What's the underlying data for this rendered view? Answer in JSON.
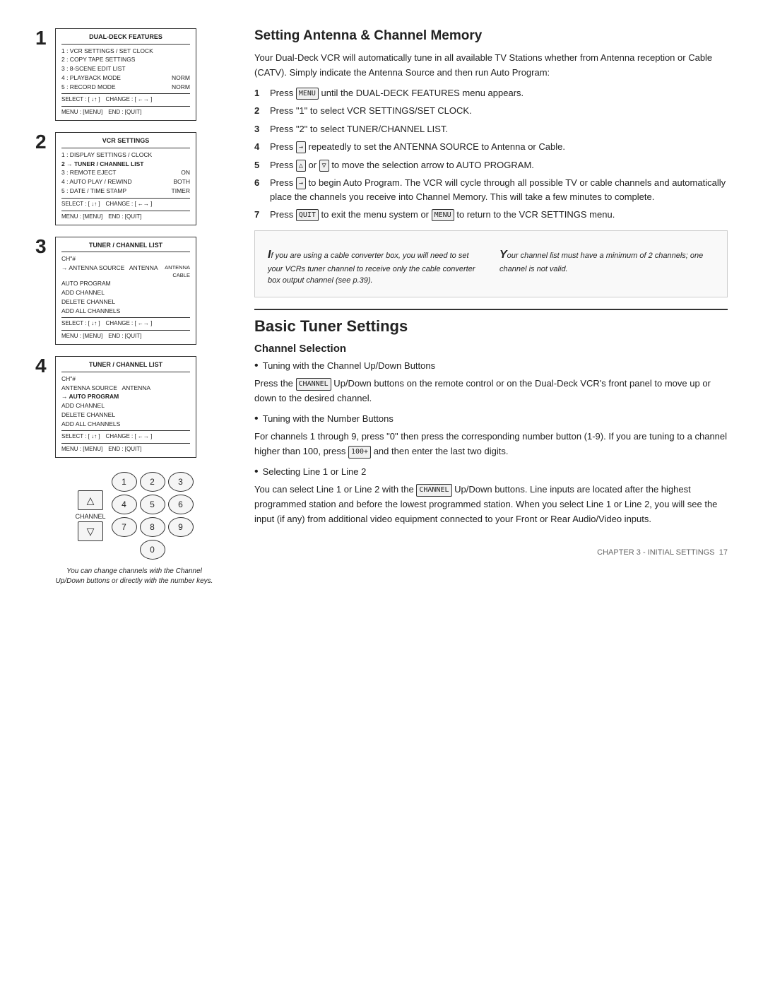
{
  "page": {
    "chapter_footer": "CHAPTER 3 - INITIAL SETTINGS",
    "page_number": "17"
  },
  "left_col": {
    "steps": [
      {
        "number": "1",
        "menu": {
          "title": "DUAL-DECK FEATURES",
          "rows": [
            {
              "num": "1 :",
              "label": "VCR SETTINGS / SET CLOCK"
            },
            {
              "num": "2 :",
              "label": "COPY TAPE SETTINGS"
            },
            {
              "num": "3 :",
              "label": "8-SCENE EDIT LIST"
            },
            {
              "num": "4 :",
              "label": "PLAYBACK MODE",
              "value": "NORM"
            },
            {
              "num": "5 :",
              "label": "RECORD MODE",
              "value": "NORM"
            }
          ],
          "footer": "SELECT : [ ↓↑ ]   CHANGE : [ ←→ ]\nMENU : [MENU]          END : [QUIT]"
        }
      },
      {
        "number": "2",
        "menu": {
          "title": "VCR SETTINGS",
          "rows": [
            {
              "num": "1 :",
              "label": "DISPLAY SETTINGS / CLOCK"
            },
            {
              "num": "2 →",
              "label": "TUNER / CHANNEL LIST"
            },
            {
              "num": "3 :",
              "label": "REMOTE EJECT",
              "value": "ON"
            },
            {
              "num": "4 :",
              "label": "AUTO PLAY / REWIND",
              "value": "BOTH"
            },
            {
              "num": "5 :",
              "label": "DATE / TIME STAMP",
              "value": "TIMER"
            }
          ],
          "footer": "SELECT : [ ↓↑ ]   CHANGE : [ ←→ ]\nMENU : [MENU]          END : [QUIT]"
        }
      },
      {
        "number": "3",
        "menu": {
          "title": "TUNER / CHANNEL LIST",
          "rows_special": [
            {
              "label": "CH\"#"
            },
            {
              "label": "→ ANTENNA SOURCE   ANTENNA",
              "sub": "ANTENNA\nCABLE"
            },
            {
              "label": "AUTO PROGRAM"
            },
            {
              "label": "ADD CHANNEL"
            },
            {
              "label": "DELETE CHANNEL"
            },
            {
              "label": "ADD ALL CHANNELS"
            }
          ],
          "footer": "SELECT : [ ↓↑ ]   CHANGE : [ ←→ ]\nMENU : [MENU]          END : [QUIT]"
        }
      },
      {
        "number": "4",
        "menu": {
          "title": "TUNER / CHANNEL LIST",
          "rows_special": [
            {
              "label": "CH\"#"
            },
            {
              "label": "ANTENNA SOURCE   ANTENNA"
            },
            {
              "label": "→ AUTO PROGRAM",
              "bold": true
            },
            {
              "label": "ADD CHANNEL"
            },
            {
              "label": "DELETE CHANNEL"
            },
            {
              "label": "ADD ALL CHANNELS"
            }
          ],
          "footer": "SELECT : [ ↓↑ ]   CHANGE : [ ←→ ]\nMENU : [MENU]          END : [QUIT]"
        }
      }
    ],
    "channel_diagram": {
      "up_arrow": "△",
      "down_arrow": "▽",
      "label": "CHANNEL",
      "buttons": [
        "1",
        "2",
        "3",
        "4",
        "5",
        "6",
        "7",
        "8",
        "9",
        "0"
      ],
      "caption": "You can change channels with the Channel Up/Down buttons or directly with the number keys."
    }
  },
  "right_col": {
    "antenna_section": {
      "title": "Setting Antenna & Channel Memory",
      "intro": "Your Dual-Deck VCR will automatically tune in all available TV Stations whether from Antenna reception or Cable (CATV). Simply indicate the Antenna Source and then run Auto Program:",
      "steps": [
        {
          "num": "1",
          "text": "Press",
          "key": "MENU",
          "text2": "until the DUAL-DECK FEATURES menu appears."
        },
        {
          "num": "2",
          "text": "Press \"1\" to select VCR SETTINGS/SET CLOCK."
        },
        {
          "num": "3",
          "text": "Press \"2\" to select TUNER/CHANNEL LIST."
        },
        {
          "num": "4",
          "text": "Press",
          "key": "→",
          "text2": "repeatedly to set the ANTENNA SOURCE to Antenna or Cable."
        },
        {
          "num": "5",
          "text": "Press",
          "key1": "△",
          "or_text": "or",
          "key2": "▽",
          "text2": "to move the selection arrow to AUTO PROGRAM."
        },
        {
          "num": "6",
          "text": "Press",
          "key": "→",
          "text2": "to begin Auto Program. The VCR will cycle through all possible TV or cable channels and automatically place the channels you receive into Channel Memory. This will take a few minutes to complete."
        },
        {
          "num": "7",
          "text": "Press",
          "key": "QUIT",
          "text2": "to exit the menu system or",
          "key3": "MENU",
          "text3": "to return to the VCR SETTINGS menu."
        }
      ],
      "tip_i": "If you are using a cable converter box, you will need to set your VCRs tuner channel to receive only the cable converter box output channel (see p.39).",
      "tip_y": "Your channel list must have a minimum of 2 channels; one channel is not valid."
    },
    "basic_tuner_section": {
      "title": "Basic Tuner Settings",
      "channel_selection": {
        "subtitle": "Channel Selection",
        "bullet1": {
          "label": "Tuning with the Channel Up/Down Buttons",
          "text": "Press the",
          "key": "CHANNEL",
          "text2": "Up/Down buttons on the remote control or on the Dual-Deck VCR's front panel to move up or down to the desired channel."
        },
        "bullet2": {
          "label": "Tuning with the Number Buttons",
          "text": "For channels 1 through 9, press \"0\" then press the corresponding number button (1-9). If you are tuning to a channel higher than 100, press",
          "key": "100+",
          "text2": "and then enter the last two digits."
        },
        "bullet3": {
          "label": "Selecting Line 1 or Line 2",
          "text": "You can select Line 1 or Line 2 with the",
          "key": "CHANNEL",
          "text2": "Up/Down buttons. Line inputs are located after the highest programmed station and before the lowest programmed station. When you select Line 1 or Line 2, you will see the input (if any) from additional video equipment connected to your Front or Rear Audio/Video inputs."
        }
      }
    }
  }
}
